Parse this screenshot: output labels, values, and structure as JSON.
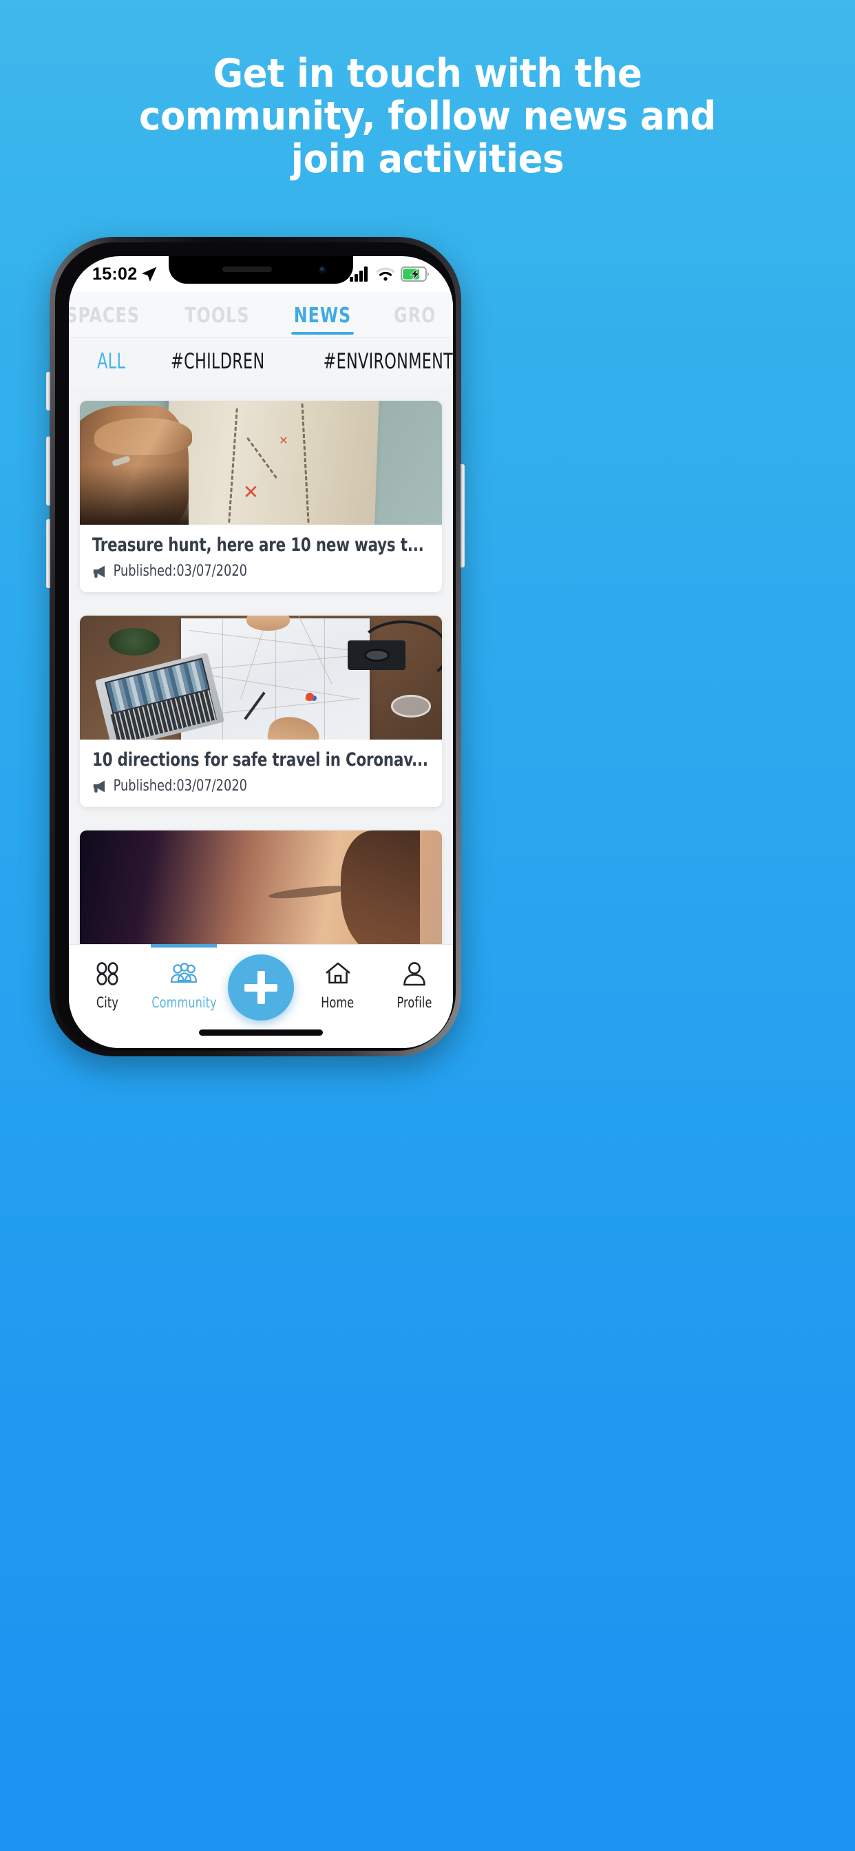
{
  "promo": {
    "headline_lines": [
      "Get in touch with the",
      "community, follow news and",
      "join activities"
    ],
    "background_top_color": "#3FB8EC",
    "background_bottom_color": "#1B93F1"
  },
  "status_bar": {
    "time": "15:02",
    "location_icon": "location-arrow-icon",
    "signal_icon": "cellular-signal-icon",
    "wifi_icon": "wifi-icon",
    "battery_icon": "battery-charging-icon",
    "battery_color": "#35CB5A"
  },
  "top_tabs": {
    "active_color": "#3EABE3",
    "inactive_color": "#D8DDE2",
    "items": [
      {
        "label": "SPACES",
        "active": false
      },
      {
        "label": "TOOLS",
        "active": false
      },
      {
        "label": "NEWS",
        "active": true
      },
      {
        "label": "GRO",
        "active": false
      }
    ]
  },
  "hashtag_filters": {
    "active_color": "#46B4E8",
    "items": [
      {
        "label": "ALL",
        "active": true
      },
      {
        "label": "#CHILDREN",
        "active": false
      },
      {
        "label": "#ENVIRONMENT",
        "active": false
      }
    ]
  },
  "news_feed": {
    "cards": [
      {
        "title": "Treasure hunt, here are 10 new ways t...",
        "meta_icon": "megaphone-icon",
        "meta": "Published:03/07/2020",
        "image_name": "hand-on-treasure-map-photo"
      },
      {
        "title": "10 directions for safe travel in Coronav...",
        "meta_icon": "megaphone-icon",
        "meta": "Published:03/07/2020",
        "image_name": "desk-with-paper-map-and-laptop-photo"
      },
      {
        "title": "",
        "meta_icon": "megaphone-icon",
        "meta": "",
        "image_name": "close-up-face-photo"
      }
    ]
  },
  "bottom_nav": {
    "active_color": "#5AB4E6",
    "fab_color": "#4FB0E4",
    "fab_icon": "plus-icon",
    "items": [
      {
        "label": "City",
        "icon": "four-circles-grid-icon",
        "active": false
      },
      {
        "label": "Community",
        "icon": "people-group-icon",
        "active": true
      },
      {
        "label": "Home",
        "icon": "house-icon",
        "active": false
      },
      {
        "label": "Profile",
        "icon": "person-icon",
        "active": false
      }
    ]
  }
}
